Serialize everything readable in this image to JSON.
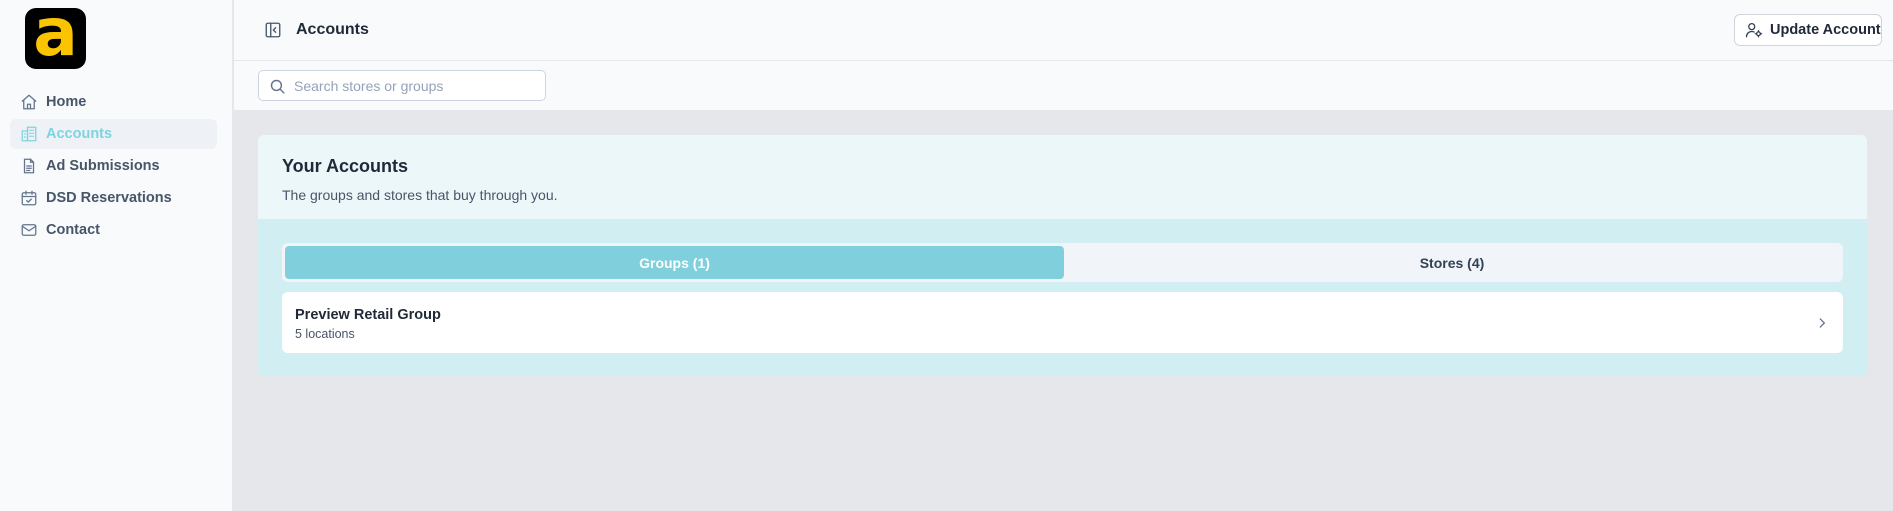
{
  "brand": {
    "logo_letter": "a",
    "logo_bg": "#000000",
    "logo_fg": "#fbc400"
  },
  "accent_color": "#7fd0dc",
  "sidebar": {
    "items": [
      {
        "label": "Home",
        "icon": "home-icon",
        "active": false
      },
      {
        "label": "Accounts",
        "icon": "building-icon",
        "active": true
      },
      {
        "label": "Ad Submissions",
        "icon": "document-icon",
        "active": false
      },
      {
        "label": "DSD Reservations",
        "icon": "calendar-check-icon",
        "active": false
      },
      {
        "label": "Contact",
        "icon": "mail-icon",
        "active": false
      }
    ]
  },
  "header": {
    "title": "Accounts",
    "update_button": "Update Account"
  },
  "search": {
    "placeholder": "Search stores or groups",
    "value": ""
  },
  "accounts_card": {
    "title": "Your Accounts",
    "subtitle": "The groups and stores that buy through you.",
    "tabs": [
      {
        "label": "Groups (1)",
        "active": true
      },
      {
        "label": "Stores (4)",
        "active": false
      }
    ],
    "groups": [
      {
        "name": "Preview Retail Group",
        "detail": "5 locations"
      }
    ]
  }
}
